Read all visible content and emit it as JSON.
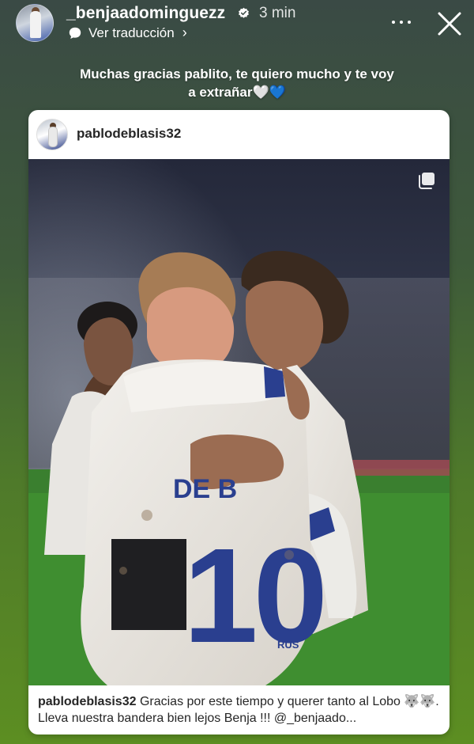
{
  "story": {
    "username": "_benjaadominguezz",
    "time": "3 min",
    "translate_label": "Ver traducción",
    "caption": "Muchas gracias pablito, te quiero mucho y te voy a extrañar🤍💙"
  },
  "post": {
    "username": "pablodeblasis32",
    "image_alt": "Dos jugadores de fútbol abrazados en el campo, uno con la camiseta número 10",
    "jersey_name": "DE B",
    "jersey_number": "10",
    "sponsor": "RUS",
    "footer_username": "pablodeblasis32",
    "footer_text": "Gracias por este tiempo y querer tanto al Lobo 🐺🐺. Lleva nuestra bandera bien lejos Benja !!! @_benjaado..."
  },
  "icons": {
    "verified": "verified-badge-icon",
    "translate": "speech-bubble-icon",
    "chevron": "chevron-right-icon",
    "more": "more-horizontal-icon",
    "close": "close-icon",
    "multi": "multiple-photos-icon"
  },
  "colors": {
    "verified_blue": "#ffffff",
    "jersey_navy": "#2a3f8f",
    "pitch_green": "#3f8e30"
  }
}
